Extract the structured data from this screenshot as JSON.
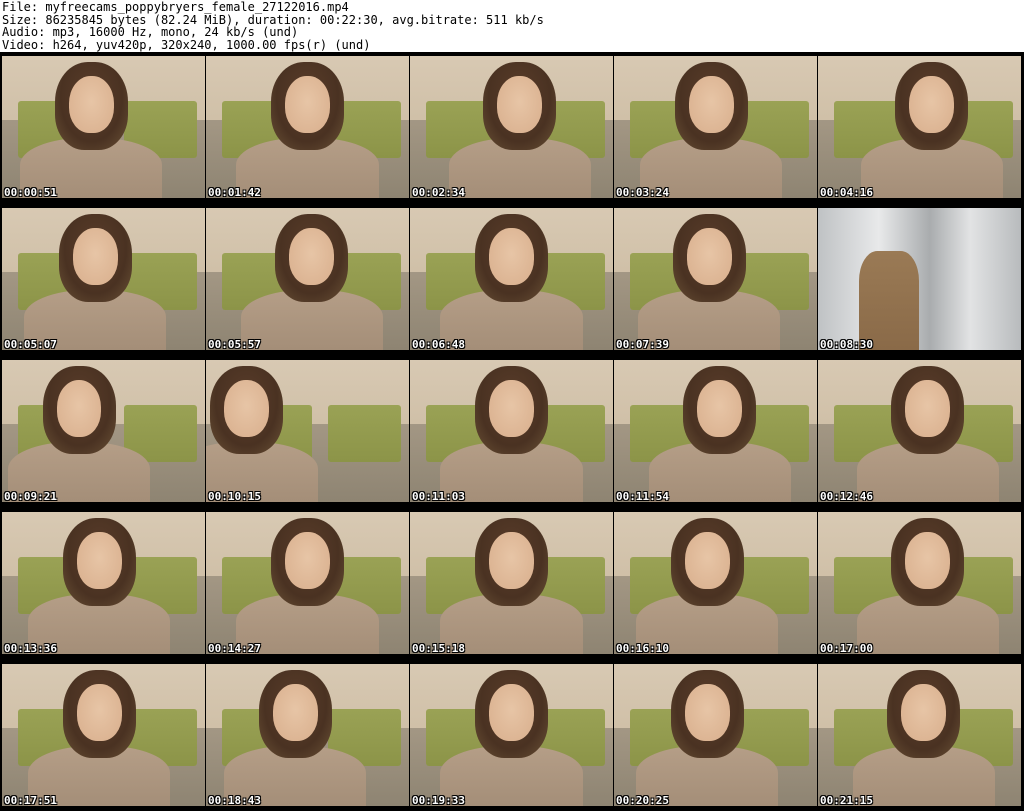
{
  "header": {
    "lines": [
      "File: myfreecams_poppybryers_female_27122016.mp4",
      "Size: 86235845 bytes (82.24 MiB), duration: 00:22:30, avg.bitrate: 511 kb/s",
      "Audio: mp3, 16000 Hz, mono, 24 kb/s (und)",
      "Video: h264, yuv420p, 320x240, 1000.00 fps(r) (und)"
    ]
  },
  "thumbnails": [
    {
      "timestamp": "00:00:51",
      "scene": "person"
    },
    {
      "timestamp": "00:01:42",
      "scene": "person"
    },
    {
      "timestamp": "00:02:34",
      "scene": "person"
    },
    {
      "timestamp": "00:03:24",
      "scene": "person"
    },
    {
      "timestamp": "00:04:16",
      "scene": "person"
    },
    {
      "timestamp": "00:05:07",
      "scene": "person"
    },
    {
      "timestamp": "00:05:57",
      "scene": "person"
    },
    {
      "timestamp": "00:06:48",
      "scene": "person"
    },
    {
      "timestamp": "00:07:39",
      "scene": "person"
    },
    {
      "timestamp": "00:08:30",
      "scene": "curtain"
    },
    {
      "timestamp": "00:09:21",
      "scene": "person"
    },
    {
      "timestamp": "00:10:15",
      "scene": "person"
    },
    {
      "timestamp": "00:11:03",
      "scene": "person"
    },
    {
      "timestamp": "00:11:54",
      "scene": "person"
    },
    {
      "timestamp": "00:12:46",
      "scene": "person"
    },
    {
      "timestamp": "00:13:36",
      "scene": "person"
    },
    {
      "timestamp": "00:14:27",
      "scene": "person"
    },
    {
      "timestamp": "00:15:18",
      "scene": "person"
    },
    {
      "timestamp": "00:16:10",
      "scene": "person"
    },
    {
      "timestamp": "00:17:00",
      "scene": "person"
    },
    {
      "timestamp": "00:17:51",
      "scene": "person"
    },
    {
      "timestamp": "00:18:43",
      "scene": "person"
    },
    {
      "timestamp": "00:19:33",
      "scene": "person"
    },
    {
      "timestamp": "00:20:25",
      "scene": "person"
    },
    {
      "timestamp": "00:21:15",
      "scene": "person"
    }
  ]
}
